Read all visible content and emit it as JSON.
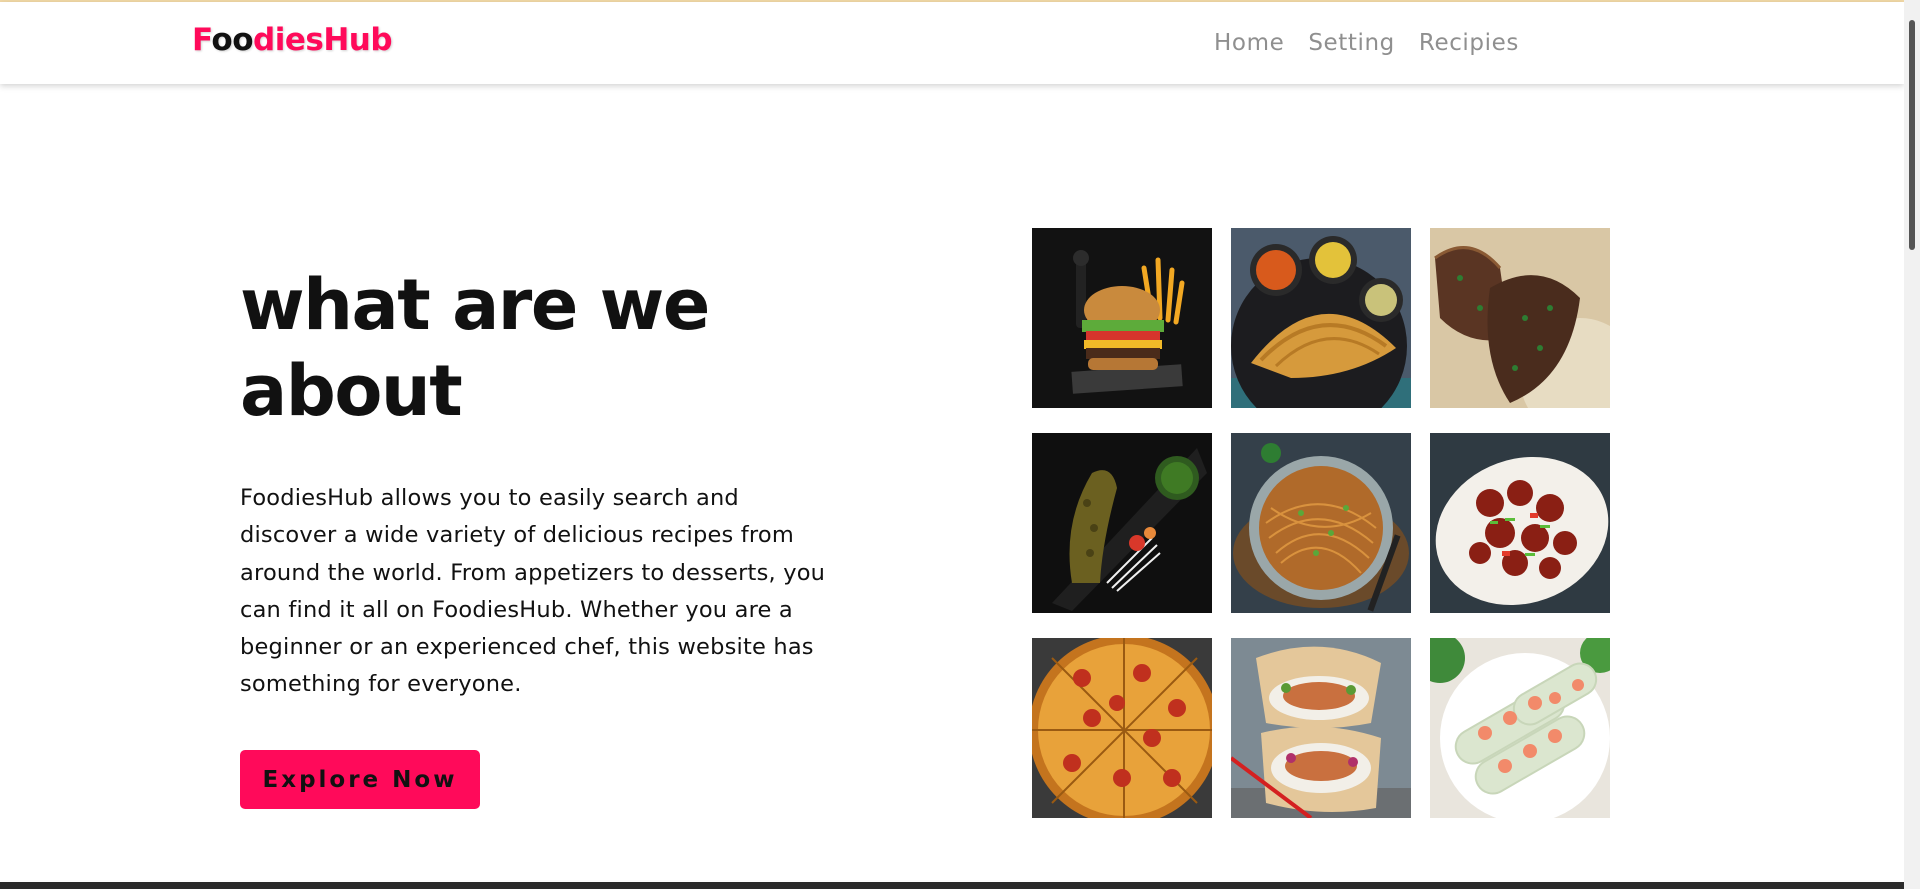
{
  "navbar": {
    "brand_prefix": "F",
    "brand_oo": "oo",
    "brand_suffix": "diesHub",
    "links": [
      {
        "label": "Home"
      },
      {
        "label": "Setting"
      },
      {
        "label": "Recipies"
      }
    ]
  },
  "about": {
    "headline_line1": "what are we",
    "headline_line2": "about",
    "description": "FoodiesHub allows you to easily search and discover a wide variety of delicious recipes from around the world. From appetizers to desserts, you can find it all on FoodiesHub. Whether you are a beginner or an experienced chef, this website has something for everyone.",
    "cta_label": "Explore Now"
  },
  "colors": {
    "brand_accent": "#ff0a5a",
    "nav_text": "#8f8f8f",
    "heading_text": "#111111"
  }
}
